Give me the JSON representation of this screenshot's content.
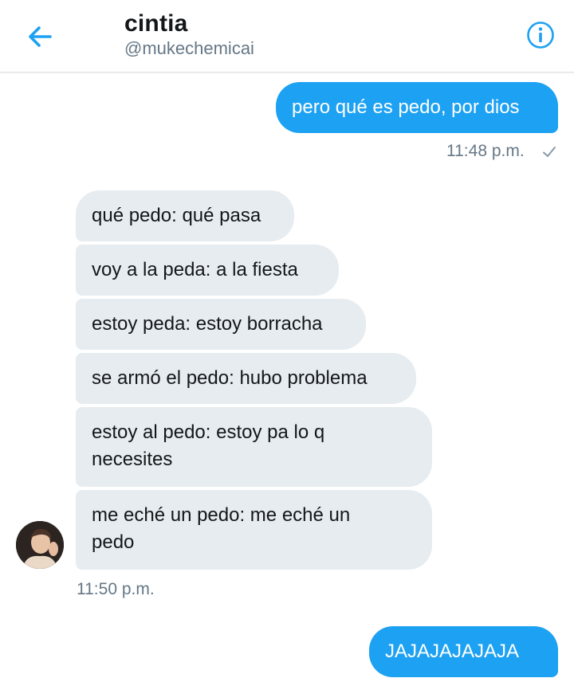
{
  "header": {
    "title": "cintia",
    "handle": "@mukechemicai",
    "back_icon": "arrow-left-icon",
    "info_icon": "info-icon",
    "accent_color": "#1da1f2"
  },
  "messages": {
    "outgoing_1": {
      "text": "pero qué es pedo, por dios",
      "time": "11:48 p.m.",
      "status_icon": "checkmark-icon"
    },
    "incoming": [
      {
        "text": "qué pedo: qué pasa"
      },
      {
        "text": "voy a la peda: a la fiesta"
      },
      {
        "text": "estoy peda: estoy borracha"
      },
      {
        "text": "se armó el pedo: hubo problema"
      },
      {
        "text": "estoy al pedo: estoy pa lo q necesites"
      },
      {
        "text": "me eché un pedo: me eché un pedo"
      }
    ],
    "incoming_time": "11:50 p.m.",
    "outgoing_2": {
      "text": "JAJAJAJAJAJA"
    }
  },
  "colors": {
    "outgoing_bubble": "#1da1f2",
    "incoming_bubble": "#e6ecf0",
    "secondary_text": "#657786"
  }
}
